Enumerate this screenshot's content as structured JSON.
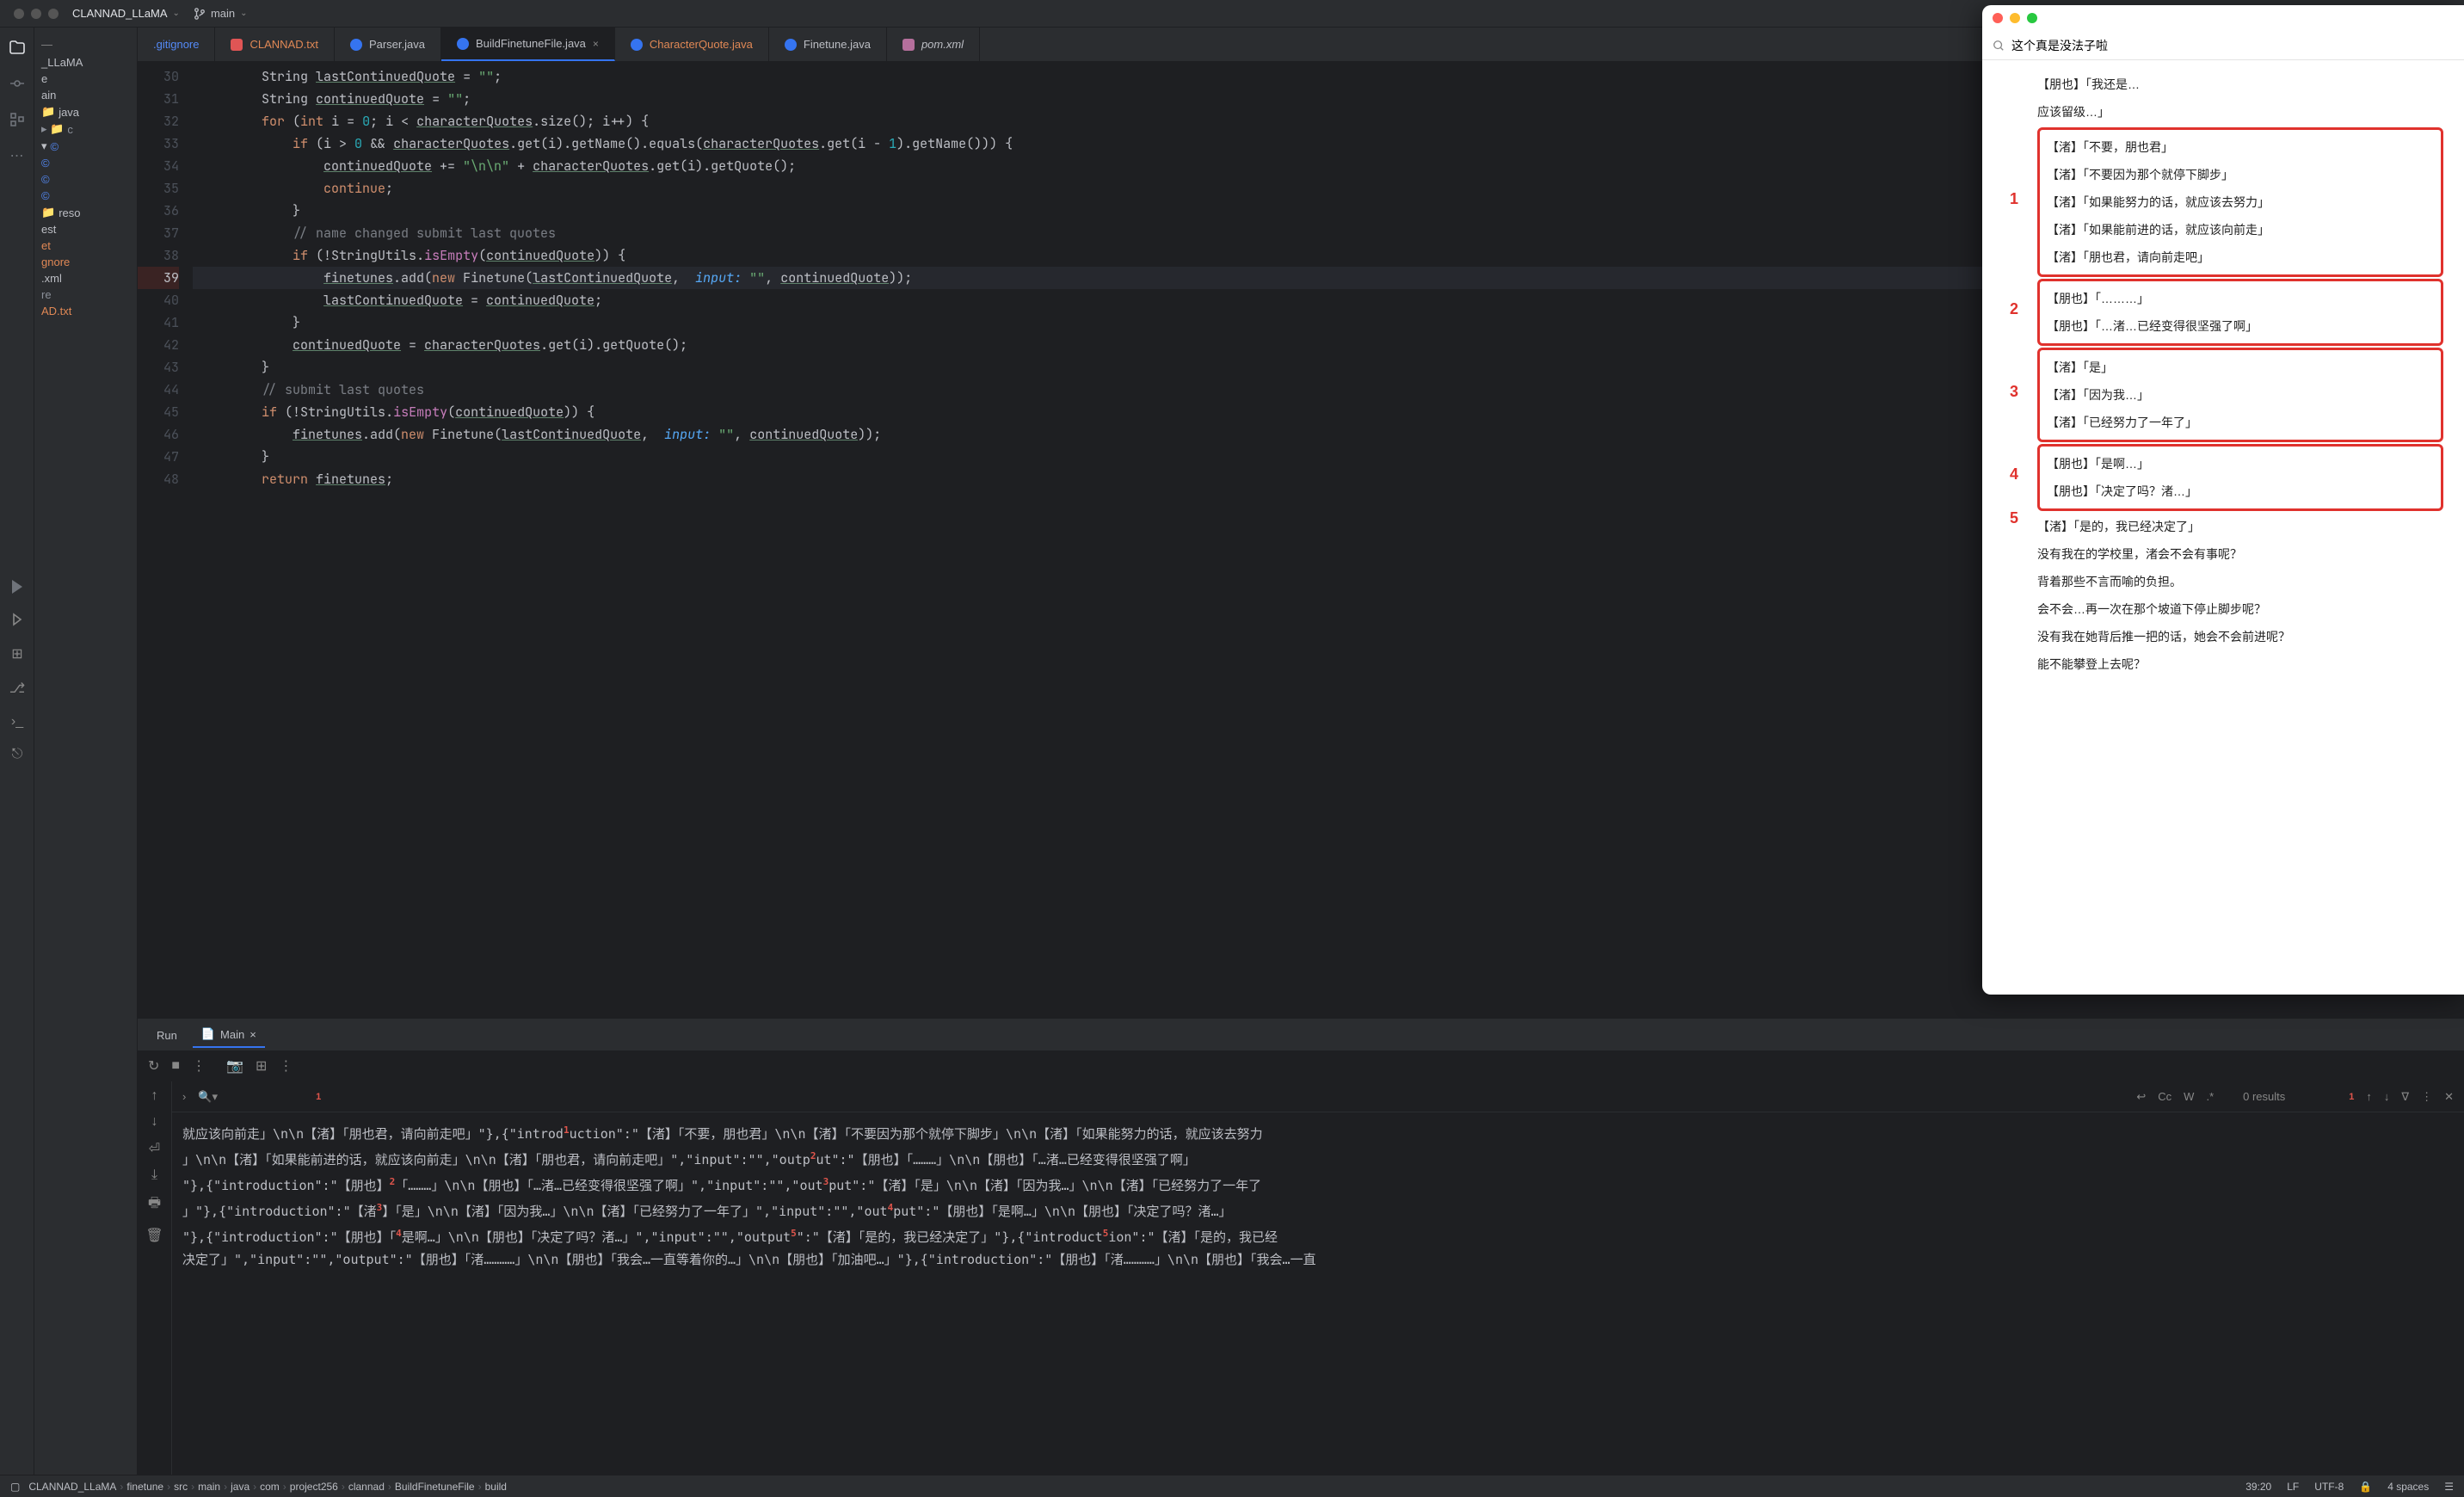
{
  "titlebar": {
    "project": "CLANNAD_LLaMA",
    "branch": "main"
  },
  "sidebar": {
    "root": "_LLaMA",
    "items": [
      "ain",
      "java",
      "c",
      "reso",
      "est",
      "et",
      "gnore",
      ".xml",
      "re",
      "AD.txt"
    ],
    "label_e": "e"
  },
  "tabs": [
    {
      "label": ".gitignore",
      "icon": "",
      "cls": "blue-text"
    },
    {
      "label": "CLANNAD.txt",
      "icon": "txt-red",
      "cls": "orange-text"
    },
    {
      "label": "Parser.java",
      "icon": "java-blue",
      "cls": ""
    },
    {
      "label": "BuildFinetuneFile.java",
      "icon": "java-blue",
      "cls": "active",
      "close": true
    },
    {
      "label": "CharacterQuote.java",
      "icon": "java-blue",
      "cls": "orange-text"
    },
    {
      "label": "Finetune.java",
      "icon": "java-blue",
      "cls": ""
    },
    {
      "label": "pom.xml",
      "icon": "xml",
      "cls": "",
      "italic": true
    }
  ],
  "code": {
    "start": 30,
    "lines": [
      "        String lastContinuedQuote = \"\";",
      "        String continuedQuote = \"\";",
      "        for (int i = 0; i < characterQuotes.size(); i++) {",
      "            if (i > 0 && characterQuotes.get(i).getName().equals(characterQuotes.get(i - 1).getName())) {",
      "                continuedQuote += \"\\n\\n\" + characterQuotes.get(i).getQuote();",
      "                continue;",
      "            }",
      "            // name changed submit last quotes",
      "            if (!StringUtils.isEmpty(continuedQuote)) {",
      "                finetunes.add(new Finetune(lastContinuedQuote,  input: \"\", continuedQuote));",
      "                lastContinuedQuote = continuedQuote;",
      "            }",
      "            continuedQuote = characterQuotes.get(i).getQuote();",
      "        }",
      "        // submit last quotes",
      "        if (!StringUtils.isEmpty(continuedQuote)) {",
      "            finetunes.add(new Finetune(lastContinuedQuote,  input: \"\", continuedQuote));",
      "        }",
      "        return finetunes;"
    ],
    "bp_line": 39
  },
  "run": {
    "tab_run": "Run",
    "tab_main": "Main",
    "find_results": "0 results",
    "options": {
      "cc": "Cc",
      "w": "W",
      "regex": ".*"
    }
  },
  "console_lines": [
    "就应该向前走」\\n\\n【渚】「朋也君，请向前走吧」\"},{\"introduction\":\"【渚】「不要，朋也君」\\n\\n【渚】「不要因为那个就停下脚步」\\n\\n【渚】「如果能努力的话，就应该去努力",
    "」\\n\\n【渚】「如果能前进的话，就应该向前走」\\n\\n【渚】「朋也君，请向前走吧」\",\"input\":\"\",\"output\":\"【朋也】「………」\\n\\n【朋也】「…渚…已经变得很坚强了啊」",
    "\"},{\"introduction\":\"【朋也】「………」\\n\\n【朋也】「…渚…已经变得很坚强了啊」\",\"input\":\"\",\"output\":\"【渚】「是」\\n\\n【渚】「因为我…」\\n\\n【渚】「已经努力了一年了",
    "」\"},{\"introduction\":\"【渚】「是」\\n\\n【渚】「因为我…」\\n\\n【渚】「已经努力了一年了」\",\"input\":\"\",\"output\":\"【朋也】「是啊…」\\n\\n【朋也】「决定了吗？渚…」",
    "\"},{\"introduction\":\"【朋也】「是啊…」\\n\\n【朋也】「决定了吗？渚…」\",\"input\":\"\",\"output\":\"【渚】「是的，我已经决定了」\"},{\"introduction\":\"【渚】「是的，我已经",
    "决定了」\",\"input\":\"\",\"output\":\"【朋也】「渚…………」\\n\\n【朋也】「我会…一直等着你的…」\\n\\n【朋也】「加油吧…」\"},{\"introduction\":\"【朋也】「渚…………」\\n\\n【朋也】「我会…一直"
  ],
  "console_sup": {
    "0": [
      {
        "pos": 37,
        "n": "1"
      }
    ],
    "1": [
      {
        "pos": 62,
        "n": "2"
      }
    ],
    "2": [
      {
        "pos": 22,
        "n": "2"
      },
      {
        "pos": 62,
        "n": "3"
      }
    ],
    "3": [
      {
        "pos": 22,
        "n": "3"
      },
      {
        "pos": 70,
        "n": "4"
      }
    ],
    "4": [
      {
        "pos": 22,
        "n": "4"
      },
      {
        "pos": 58,
        "n": "5"
      },
      {
        "pos": 86,
        "n": "5"
      }
    ]
  },
  "breadcrumb": [
    "CLANNAD_LLaMA",
    "finetune",
    "src",
    "main",
    "java",
    "com",
    "project256",
    "clannad",
    "BuildFinetuneFile",
    "build"
  ],
  "statusbar": {
    "pos": "39:20",
    "lf": "LF",
    "enc": "UTF-8",
    "indent": "4 spaces"
  },
  "notes": {
    "search": "这个真是没法子啦",
    "pre": [
      "【朋也】「我还是…",
      "应该留级…」"
    ],
    "box1": [
      "【渚】「不要，朋也君」",
      "【渚】「不要因为那个就停下脚步」",
      "【渚】「如果能努力的话，就应该去努力」",
      "【渚】「如果能前进的话，就应该向前走」",
      "【渚】「朋也君，请向前走吧」"
    ],
    "box2": [
      "【朋也】「………」",
      "【朋也】「…渚…已经变得很坚强了啊」"
    ],
    "box3": [
      "【渚】「是」",
      "【渚】「因为我…」",
      "【渚】「已经努力了一年了」"
    ],
    "box4": [
      "【朋也】「是啊…」",
      "【朋也】「决定了吗？渚…」"
    ],
    "after5": "【渚】「是的，我已经决定了」",
    "post": [
      "没有我在的学校里，渚会不会有事呢？",
      "背着那些不言而喻的负担。",
      "会不会…再一次在那个坡道下停止脚步呢？",
      "没有我在她背后推一把的话，她会不会前进呢？",
      "能不能攀登上去呢？"
    ],
    "labels": {
      "1": "1",
      "2": "2",
      "3": "3",
      "4": "4",
      "5": "5"
    }
  }
}
